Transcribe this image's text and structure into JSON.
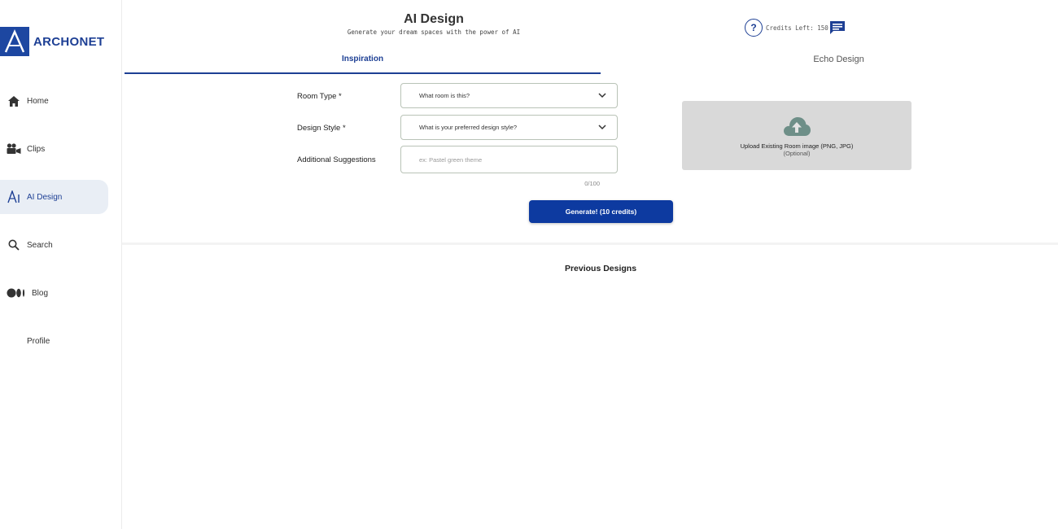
{
  "brand": {
    "name": "ARCHONET",
    "color": "#1d47a1"
  },
  "sidebar": {
    "items": [
      {
        "label": "Home",
        "icon": "home-icon",
        "active": false
      },
      {
        "label": "Clips",
        "icon": "video-camera-icon",
        "active": false
      },
      {
        "label": "AI Design",
        "icon": "ai-design-icon",
        "active": true
      },
      {
        "label": "Search",
        "icon": "search-icon",
        "active": false
      },
      {
        "label": "Blog",
        "icon": "medium-icon",
        "active": false
      },
      {
        "label": "Profile",
        "icon": "",
        "active": false
      }
    ]
  },
  "header": {
    "title": "AI Design",
    "subtitle": "Generate your dream spaces with the power of AI",
    "credits_text": "Credits Left: 150",
    "help_icon": "help-circle-icon",
    "chat_icon": "chat-icon"
  },
  "tabs": [
    {
      "label": "Inspiration",
      "active": true
    },
    {
      "label": "Echo Design",
      "active": false
    }
  ],
  "form": {
    "room_type": {
      "label": "Room Type *",
      "value": "What room is this?"
    },
    "design_style": {
      "label": "Design Style *",
      "value": "What is your preferred design style?"
    },
    "suggestions": {
      "label": "Additional Suggestions",
      "placeholder": "ex: Pastel green theme",
      "counter": "0/100"
    }
  },
  "upload": {
    "title": "Upload Existing Room image (PNG, JPG)",
    "optional": "(Optional)",
    "icon": "cloud-upload-icon"
  },
  "generate_label": "Generate! (10 credits)",
  "previous_designs_title": "Previous Designs",
  "colors": {
    "accent": "#1d3f94",
    "button": "#0d3aa0",
    "active_bg": "#e9eef5",
    "upload_bg": "#d9d9d9"
  }
}
